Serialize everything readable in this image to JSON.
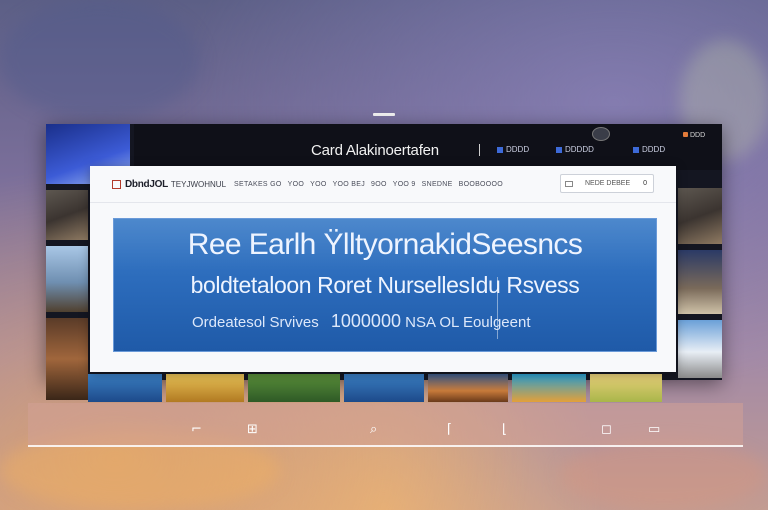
{
  "window": {
    "title": "Card Alakinoertafen"
  },
  "header": {
    "links": [
      "DDDD",
      "DDDDD",
      "DDDD"
    ],
    "right_label": "DDD"
  },
  "card": {
    "brand": "DbndJOL",
    "brand_sub": "TEYJWOHNUL",
    "nav": [
      "SETAKES GO",
      "YOO",
      "YOO",
      "YOO BEJ",
      "9OO",
      "YOO 9",
      "SNEDNE",
      "BOOBOOOO"
    ],
    "search": {
      "placeholder": "NEDE DEBEE",
      "count": "0"
    }
  },
  "hero": {
    "line1": "Ree Earlh ŸlltyornakidSeesncs",
    "line2": "boldtetaloon Roret NursellesIdu Rsvess",
    "line3_label": "Ordeatesol Srvives",
    "line3_value": "1000000",
    "line3_suffix": "NSA OL Eoulgeent"
  },
  "taskbar": {
    "icons": [
      "pin-icon",
      "grid-icon",
      "search-icon",
      "file-icon",
      "edit-icon",
      "window-icon",
      "minus-icon"
    ]
  },
  "colors": {
    "accent": "#2c6cbc",
    "frame": "#141621",
    "card": "#f8f9fb"
  }
}
